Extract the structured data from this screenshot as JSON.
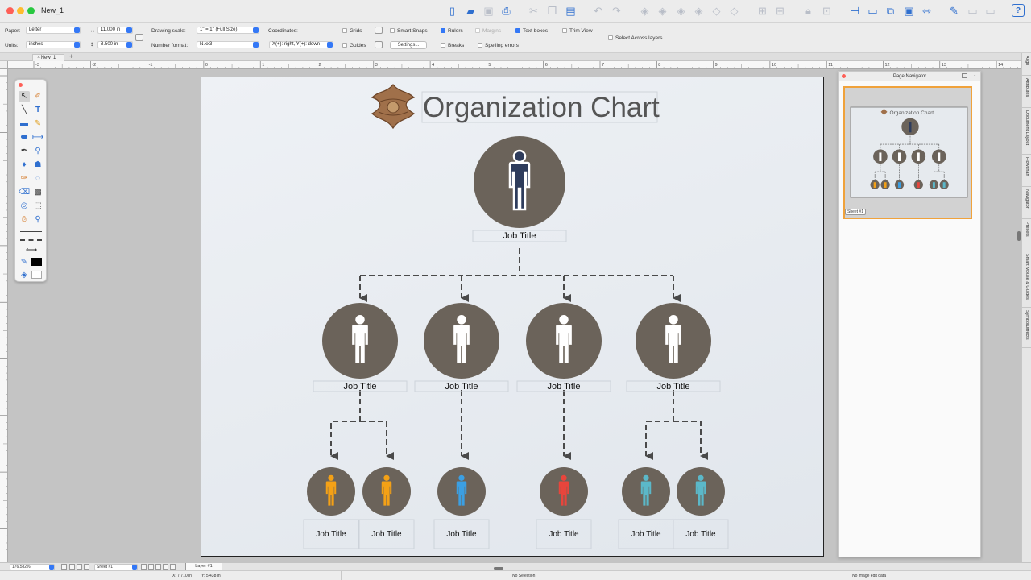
{
  "window": {
    "title": "New_1"
  },
  "toolbar": {
    "icons": [
      "new-document-icon",
      "open-folder-icon",
      "save-icon",
      "print-icon",
      "cut-icon",
      "copy-icon",
      "paste-icon",
      "undo-icon",
      "redo-icon",
      "arrange-front-icon",
      "arrange-forward-icon",
      "arrange-backward-icon",
      "arrange-back-icon",
      "layers-icon",
      "group-icon",
      "ungroup-icon",
      "lock-icon",
      "unlock-icon",
      "align-icon",
      "frame-icon",
      "image-icon",
      "picture-icon",
      "fit-icon",
      "edit-icon",
      "view-icon",
      "screen-icon",
      "help-icon"
    ]
  },
  "options": {
    "paper_label": "Paper:",
    "paper_value": "Letter",
    "units_label": "Units:",
    "units_value": "inches",
    "width_value": "11.000 in",
    "height_value": "8.500 in",
    "scale_label": "Drawing scale:",
    "scale_value": "1\" = 1\"   (Full Size)",
    "numfmt_label": "Number format:",
    "numfmt_value": "N.xx3",
    "coords_label": "Coordinates:",
    "coords_value": "X(+): right, Y(+): down",
    "grids_label": "Grids",
    "guides_label": "Guides",
    "smart_snaps_label": "Smart Snaps",
    "settings_label": "Settings...",
    "rulers_label": "Rulers",
    "margins_label": "Margins",
    "text_boxes_label": "Text boxes",
    "trim_view_label": "Trim View",
    "breaks_label": "Breaks",
    "spelling_label": "Spelling errors",
    "select_across_label": "Select Across layers",
    "checked": {
      "rulers": true,
      "text_boxes": true
    }
  },
  "tabs": {
    "doc_tab": "New_1",
    "close": "×",
    "add": "+"
  },
  "ruler": {
    "ticks": [
      "-3",
      "-2",
      "-1",
      "0",
      "1",
      "2",
      "3",
      "4",
      "5",
      "6",
      "7",
      "8",
      "9",
      "10",
      "11",
      "12",
      "13",
      "14"
    ]
  },
  "palette": {
    "tools": [
      "arrow-tool-icon",
      "brush-tool-icon",
      "line-tool-icon",
      "text-tool-icon",
      "rectangle-tool-icon",
      "pencil-tool-icon",
      "ellipse-tool-icon",
      "dimension-tool-icon",
      "pen-tool-icon",
      "eyedropper-tool-icon",
      "marker-tool-icon",
      "shape-tool-icon",
      "brush-alt-tool-icon",
      "circle-tool-icon",
      "eraser-tool-icon",
      "stamp-tool-icon",
      "lasso-tool-icon",
      "marquee-tool-icon",
      "hand-tool-icon",
      "zoom-tool-icon"
    ]
  },
  "org_chart": {
    "title": "Organization Chart",
    "root": {
      "label": "Job Title",
      "figure_color": "#2e3c5c"
    },
    "level2": [
      {
        "label": "Job Title",
        "figure_color": "#ffffff"
      },
      {
        "label": "Job Title",
        "figure_color": "#ffffff"
      },
      {
        "label": "Job Title",
        "figure_color": "#ffffff"
      },
      {
        "label": "Job Title",
        "figure_color": "#ffffff"
      }
    ],
    "level3": [
      {
        "label": "Job Title",
        "figure_color": "#f4a116"
      },
      {
        "label": "Job Title",
        "figure_color": "#f4a116"
      },
      {
        "label": "Job Title",
        "figure_color": "#3b9fe3"
      },
      {
        "label": "Job Title",
        "figure_color": "#e8453c"
      },
      {
        "label": "Job Title",
        "figure_color": "#5bb8c9"
      },
      {
        "label": "Job Title",
        "figure_color": "#5bb8c9"
      }
    ],
    "circle_color": "#6b635a",
    "connector_color": "#4a4a4a"
  },
  "navigator": {
    "title": "Page Navigator",
    "sheet_label": "Sheet #1"
  },
  "side_tabs": [
    "Align",
    "Attributes",
    "Document Layout",
    "Flowchart",
    "Navigator",
    "Presets",
    "Smart Mouse & Guides",
    "SymbolDiffects"
  ],
  "bottom": {
    "zoom_value": "176.582%",
    "sheet_value": "Sheet #1",
    "layer_tab": "Layer #1"
  },
  "status": {
    "x_value": "X: 7.710 in",
    "y_value": "Y: 5.438 in",
    "selection": "No Selection",
    "image_info": "No image edit data"
  }
}
